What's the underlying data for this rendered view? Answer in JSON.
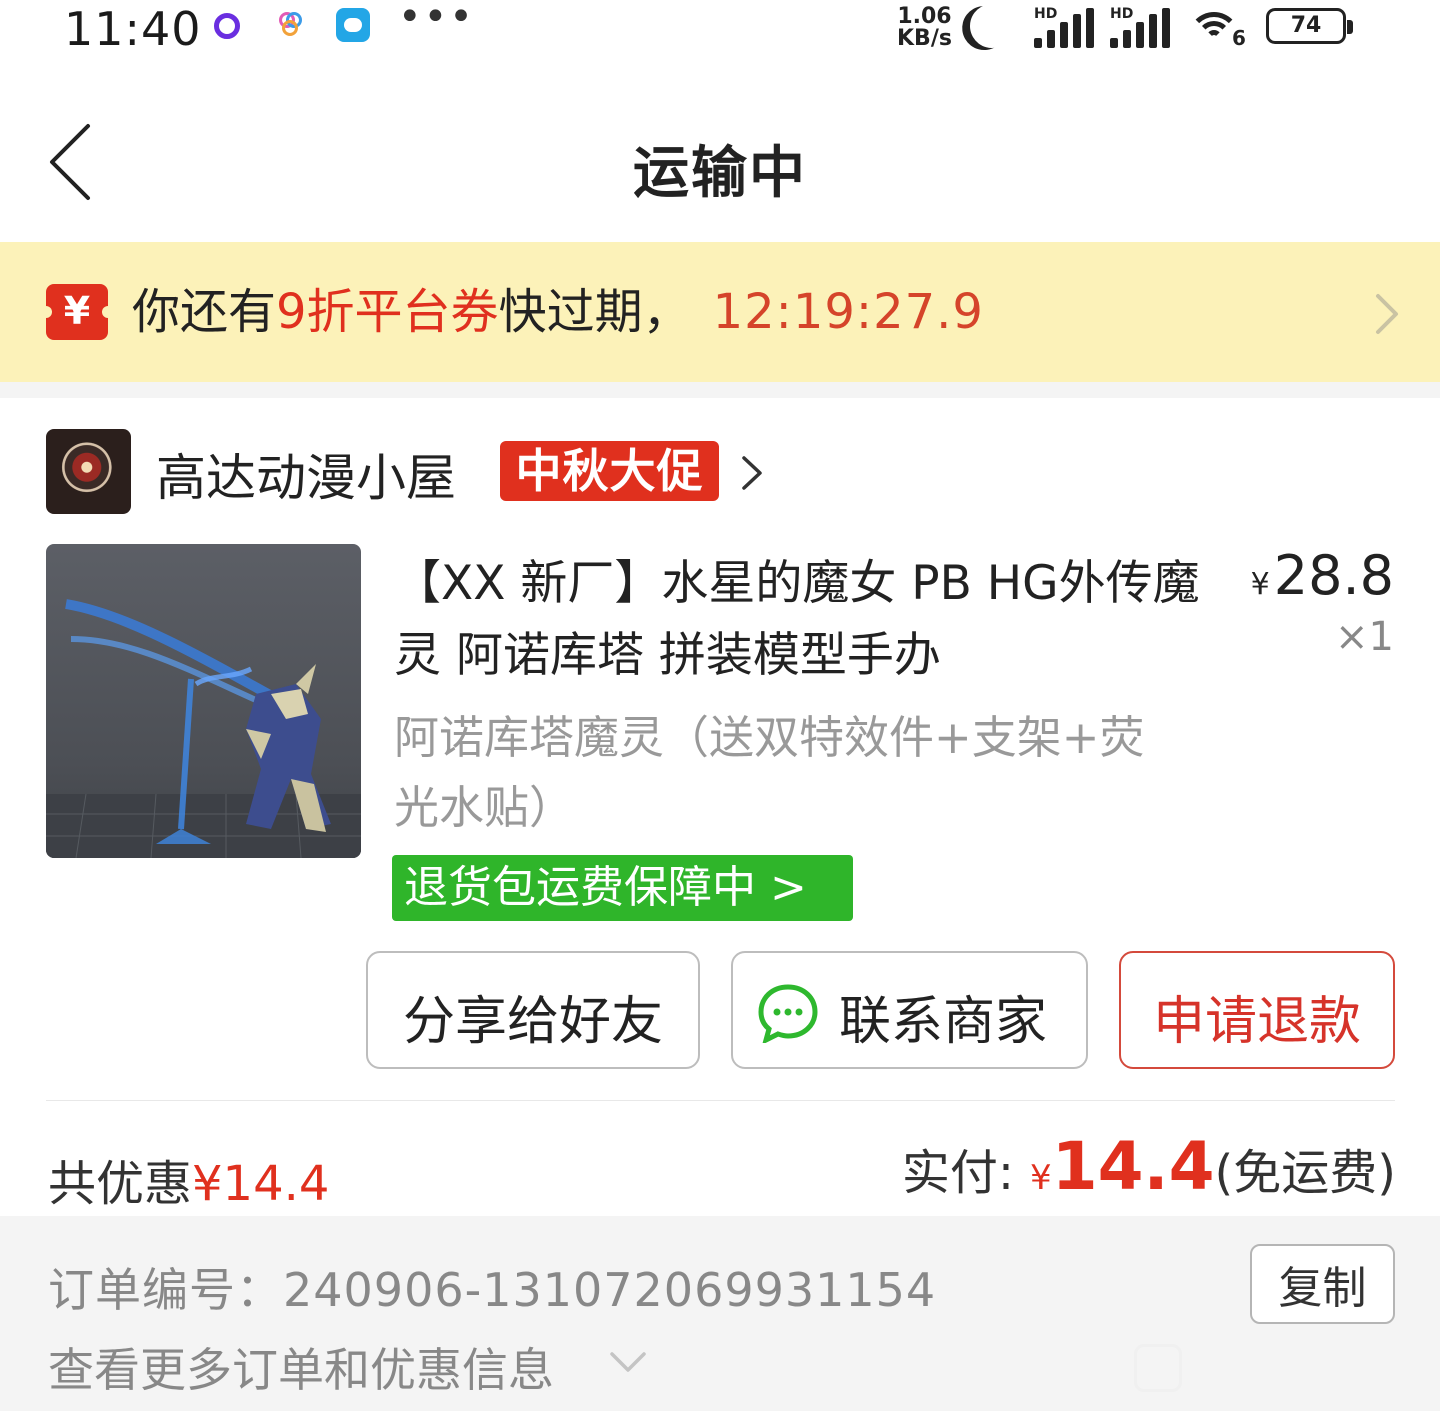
{
  "status_bar": {
    "time": "11:40",
    "net_speed_value": "1.06",
    "net_speed_unit": "KB/s",
    "hd_label_1": "HD",
    "hd_label_2": "HD",
    "wifi_label": "6",
    "battery": "74",
    "overflow_dots": "•••"
  },
  "nav": {
    "title": "运输中"
  },
  "coupon": {
    "icon_glyph": "¥",
    "prefix": "你还有",
    "highlight": "9折平台券",
    "suffix": "快过期，",
    "countdown": "12:19:27.9"
  },
  "shop": {
    "name": "高达动漫小屋",
    "promo_tag": "中秋大促"
  },
  "product": {
    "title": "【XX 新厂】水星的魔女 PB HG外传魔灵 阿诺库塔 拼装模型手办",
    "currency": "¥",
    "price": "28.8",
    "quantity": "×1",
    "sku": "阿诺库塔魔灵（送双特效件+支架+荧光水贴）",
    "guarantee": "退货包运费保障中 >"
  },
  "actions": {
    "share": "分享给好友",
    "contact": "联系商家",
    "refund": "申请退款"
  },
  "totals": {
    "discount_label": "共优惠",
    "discount_amount": "¥14.4",
    "paid_label": "实付:",
    "paid_currency": "¥",
    "paid_amount": "14.4",
    "shipping_note": "(免运费)"
  },
  "order_info": {
    "order_no_label": "订单编号：",
    "order_no": "240906-131072069931154",
    "copy": "复制",
    "more": "查看更多订单和优惠信息"
  },
  "colors": {
    "accent_red": "#e0301e",
    "guarantee_green": "#2fb52a",
    "banner_yellow": "#fcf2b9",
    "wechat_green": "#2eb82e"
  },
  "icons": [
    "back-arrow-icon",
    "coupon-icon",
    "chevron-right-icon",
    "chat-bubble-icon",
    "chevron-down-icon"
  ]
}
